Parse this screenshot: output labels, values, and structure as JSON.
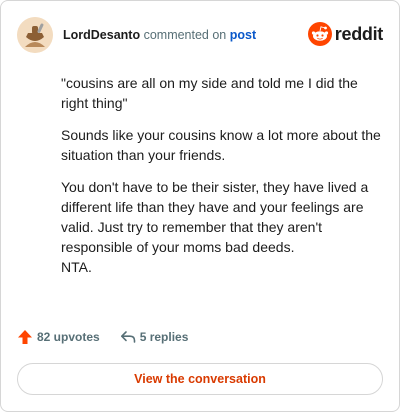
{
  "header": {
    "username": "LordDesanto",
    "verb": "commented on",
    "post_link": "post",
    "brand": "reddit"
  },
  "comment": {
    "paragraphs": [
      "\"cousins are all on my side and told me I did the right thing\"",
      "Sounds like your cousins know a lot more about the situation than your friends.",
      "You don't have to be their sister, they have lived a different life than they have and your feelings are valid. Just try to remember that they aren't responsible of your moms bad deeds.",
      "NTA."
    ]
  },
  "actions": {
    "upvotes": "82 upvotes",
    "replies": "5 replies"
  },
  "cta": {
    "label": "View the conversation"
  },
  "colors": {
    "brand_orange": "#ff4500",
    "cta_text": "#d93a00",
    "link_blue": "#0a58ca",
    "muted": "#576f76"
  },
  "icons": {
    "avatar": "user-avatar",
    "brand": "reddit-snoo-icon",
    "upvote": "upvote-arrow-icon",
    "reply": "reply-arrow-icon"
  }
}
